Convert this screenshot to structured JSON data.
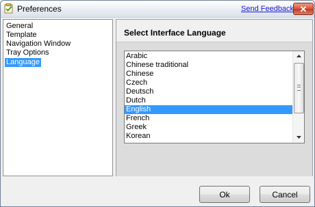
{
  "window": {
    "title": "Preferences",
    "feedback_link": "Send Feedback",
    "close_label": "✕"
  },
  "nav": {
    "items": [
      {
        "label": "General",
        "selected": false
      },
      {
        "label": "Template",
        "selected": false
      },
      {
        "label": "Navigation Window",
        "selected": false
      },
      {
        "label": "Tray Options",
        "selected": false
      },
      {
        "label": "Language",
        "selected": true
      }
    ]
  },
  "language_section": {
    "title": "Select Interface Language",
    "languages": [
      "Arabic",
      "Chinese traditional",
      "Chinese",
      "Czech",
      "Deutsch",
      "Dutch",
      "English",
      "French",
      "Greek",
      "Korean"
    ],
    "selected": "English"
  },
  "buttons": {
    "ok": "Ok",
    "cancel": "Cancel"
  },
  "icons": {
    "app": "preferences-checklist-icon",
    "close": "close-icon",
    "scroll_up": "scroll-up-arrow-icon",
    "scroll_down": "scroll-down-arrow-icon"
  },
  "colors": {
    "selection": "#3399ff",
    "link": "#1b1bd0",
    "close_button": "#c53b20"
  }
}
